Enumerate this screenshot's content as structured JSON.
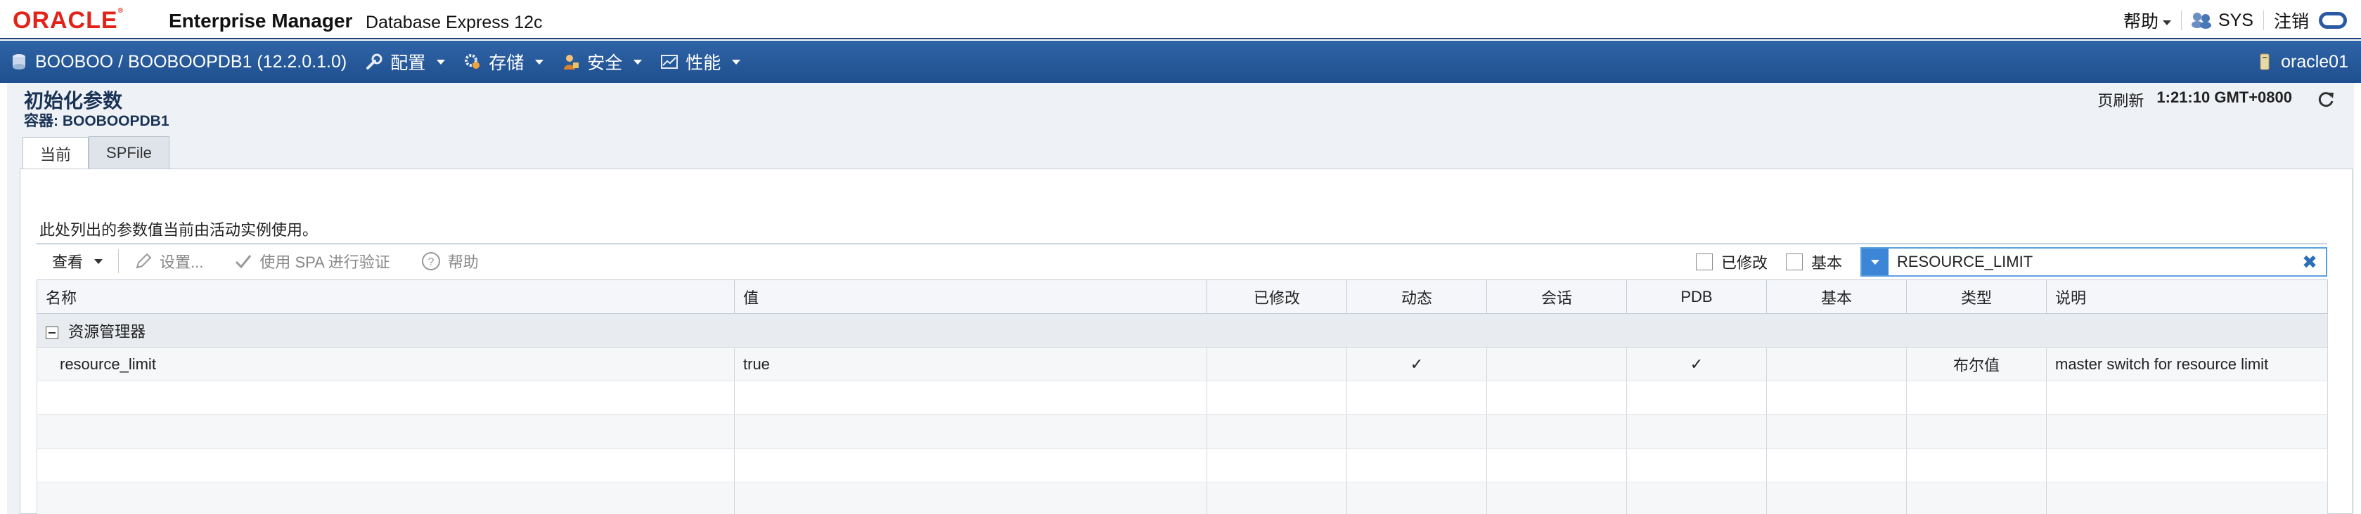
{
  "header": {
    "logo_text": "ORACLE",
    "app_title": "Enterprise Manager",
    "app_subtitle": "Database Express 12c",
    "help_label": "帮助",
    "user_label": "SYS",
    "logout_label": "注销"
  },
  "nav": {
    "db_label": "BOOBOO / BOOBOOPDB1 (12.2.0.1.0)",
    "menus": [
      {
        "label": "配置",
        "icon": "wrench-icon"
      },
      {
        "label": "存储",
        "icon": "storage-gear-icon"
      },
      {
        "label": "安全",
        "icon": "security-user-icon"
      },
      {
        "label": "性能",
        "icon": "performance-chart-icon"
      }
    ],
    "host_label": "oracle01"
  },
  "page": {
    "title": "初始化参数",
    "container_label": "容器:",
    "container_value": "BOOBOOPDB1",
    "refresh_label": "页刷新",
    "refresh_time": "1:21:10 GMT+0800",
    "tabs": [
      {
        "label": "当前",
        "active": true
      },
      {
        "label": "SPFile",
        "active": false
      }
    ],
    "info_text": "此处列出的参数值当前由活动实例使用。"
  },
  "toolbar": {
    "view_label": "查看",
    "set_label": "设置...",
    "spa_label": "使用 SPA 进行验证",
    "help_label": "帮助",
    "filter_modified_label": "已修改",
    "filter_basic_label": "基本",
    "search_value": "RESOURCE_LIMIT"
  },
  "table": {
    "columns": [
      "名称",
      "值",
      "已修改",
      "动态",
      "会话",
      "PDB",
      "基本",
      "类型",
      "说明"
    ],
    "group_label": "资源管理器",
    "rows": [
      {
        "name": "resource_limit",
        "value": "true",
        "modified": "",
        "dynamic": "✓",
        "session": "",
        "pdb": "✓",
        "basic": "",
        "type": "布尔值",
        "description": "master switch for resource limit"
      }
    ]
  },
  "colors": {
    "nav_blue": "#1f4f8f",
    "oracle_red": "#e2231a",
    "search_accent": "#3b86d6"
  }
}
